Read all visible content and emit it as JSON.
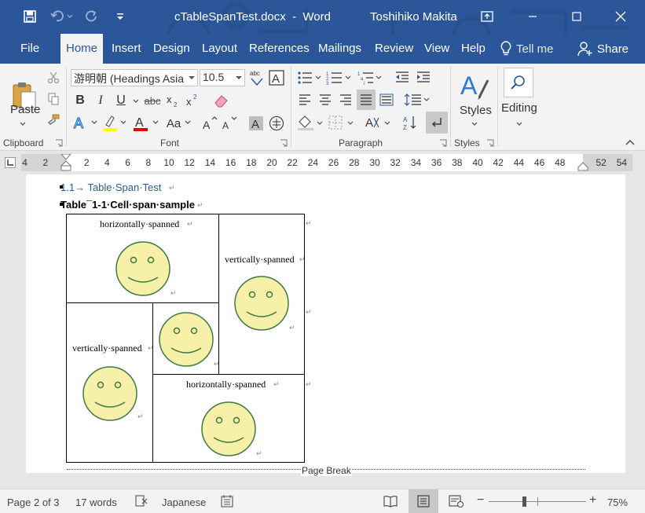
{
  "title_bar": {
    "document_title": "cTableSpanTest.docx  -  Word",
    "user_name": "Toshihiko Makita",
    "quick_access": [
      "save-icon",
      "undo-icon",
      "redo-icon",
      "customize-icon"
    ]
  },
  "tabs": [
    {
      "label": "File"
    },
    {
      "label": "Home",
      "active": true
    },
    {
      "label": "Insert"
    },
    {
      "label": "Design"
    },
    {
      "label": "Layout"
    },
    {
      "label": "References"
    },
    {
      "label": "Mailings"
    },
    {
      "label": "Review"
    },
    {
      "label": "View"
    },
    {
      "label": "Help"
    }
  ],
  "tell_me": "Tell me",
  "share": "Share",
  "ribbon": {
    "clipboard": {
      "label": "Clipboard",
      "paste_label": "Paste"
    },
    "font": {
      "label": "Font",
      "font_name": "游明朝 (Headings Asia",
      "font_size": "10.5"
    },
    "paragraph": {
      "label": "Paragraph"
    },
    "styles": {
      "label": "Styles",
      "button": "Styles"
    },
    "editing": {
      "button": "Editing"
    }
  },
  "ruler": {
    "left_ticks": [
      "4",
      "2"
    ],
    "ticks": [
      "2",
      "4",
      "6",
      "8",
      "10",
      "12",
      "14",
      "16",
      "18",
      "20",
      "22",
      "24",
      "26",
      "28",
      "30",
      "32",
      "34",
      "36",
      "38",
      "40",
      "42",
      "44",
      "46",
      "48"
    ],
    "right_ticks": [
      "52",
      "54"
    ]
  },
  "document": {
    "heading": "1.1→ Table·Span·Test",
    "caption": "Table¯1-1·Cell·span·sample",
    "cells": {
      "top_left": "horizontally·spanned",
      "right_top": "vertically·spanned",
      "left_bottom": "vertically·spanned",
      "bottom_right": "horizontally·spanned"
    },
    "page_break": "Page Break"
  },
  "status_bar": {
    "page": "Page 2 of 3",
    "words": "17 words",
    "language": "Japanese",
    "zoom": "75%",
    "zoom_level": 0.75
  },
  "colors": {
    "brand": "#2b579a",
    "smiley_fill": "#f7f0a8",
    "smiley_stroke": "#3e7a43"
  }
}
